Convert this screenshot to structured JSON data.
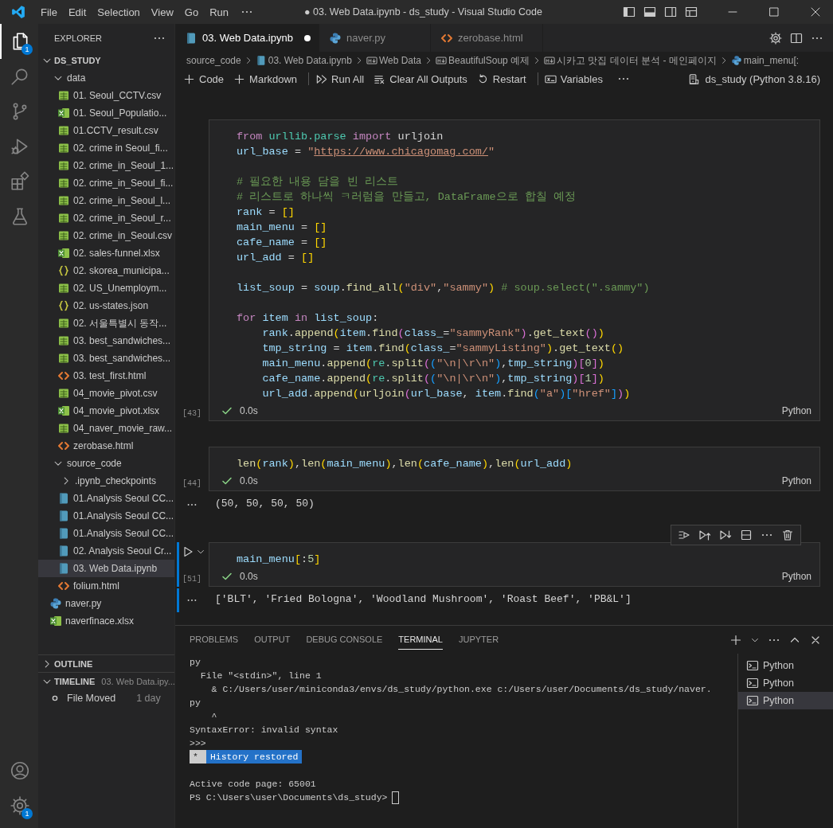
{
  "window": {
    "title": "● 03. Web Data.ipynb - ds_study - Visual Studio Code",
    "menu": [
      "File",
      "Edit",
      "Selection",
      "View",
      "Go",
      "Run"
    ]
  },
  "activity_bar": {
    "top": [
      {
        "kind": "explorer",
        "selected": true,
        "badge": "1"
      },
      {
        "kind": "search",
        "selected": false
      },
      {
        "kind": "source-control",
        "selected": false
      },
      {
        "kind": "run-debug",
        "selected": false
      },
      {
        "kind": "extensions",
        "selected": false
      },
      {
        "kind": "testing",
        "selected": false
      }
    ],
    "bottom": [
      {
        "kind": "account"
      },
      {
        "kind": "settings",
        "badge": "1"
      }
    ]
  },
  "sidebar": {
    "title": "EXPLORER",
    "root": {
      "label": "DS_STUDY",
      "expanded": true
    },
    "tree": [
      {
        "label": "data",
        "kind": "folder",
        "expanded": true,
        "selected": false,
        "children": [
          {
            "label": "01. Seoul_CCTV.csv",
            "kind": "csv",
            "selected": false
          },
          {
            "label": "01. Seoul_Populatio...",
            "kind": "xlsx",
            "selected": false
          },
          {
            "label": "01.CCTV_result.csv",
            "kind": "csv",
            "selected": false
          },
          {
            "label": "02. crime in Seoul_fi...",
            "kind": "csv",
            "selected": false
          },
          {
            "label": "02. crime_in_Seoul_1...",
            "kind": "csv",
            "selected": false
          },
          {
            "label": "02. crime_in_Seoul_fi...",
            "kind": "csv",
            "selected": false
          },
          {
            "label": "02. crime_in_Seoul_l...",
            "kind": "csv",
            "selected": false
          },
          {
            "label": "02. crime_in_Seoul_r...",
            "kind": "csv",
            "selected": false
          },
          {
            "label": "02. crime_in_Seoul.csv",
            "kind": "csv",
            "selected": false
          },
          {
            "label": "02. sales-funnel.xlsx",
            "kind": "xlsx",
            "selected": false
          },
          {
            "label": "02. skorea_municipa...",
            "kind": "json",
            "selected": false
          },
          {
            "label": "02. US_Unemploym...",
            "kind": "csv",
            "selected": false
          },
          {
            "label": "02. us-states.json",
            "kind": "json",
            "selected": false
          },
          {
            "label": "02. 서울특별시 동작...",
            "kind": "csv",
            "selected": false
          },
          {
            "label": "03. best_sandwiches...",
            "kind": "csv",
            "selected": false
          },
          {
            "label": "03. best_sandwiches...",
            "kind": "csv",
            "selected": false
          },
          {
            "label": "03. test_first.html",
            "kind": "html",
            "selected": false
          },
          {
            "label": "04_movie_pivot.csv",
            "kind": "csv",
            "selected": false
          },
          {
            "label": "04_movie_pivot.xlsx",
            "kind": "xlsx",
            "selected": false
          },
          {
            "label": "04_naver_movie_raw...",
            "kind": "csv",
            "selected": false
          },
          {
            "label": "zerobase.html",
            "kind": "html",
            "selected": false
          }
        ]
      },
      {
        "label": "source_code",
        "kind": "folder",
        "expanded": true,
        "selected": false,
        "children": [
          {
            "label": ".ipynb_checkpoints",
            "kind": "folder",
            "expanded": false,
            "selected": false
          },
          {
            "label": "01.Analysis Seoul CC...",
            "kind": "ipynb",
            "selected": false
          },
          {
            "label": "01.Analysis Seoul CC...",
            "kind": "ipynb",
            "selected": false
          },
          {
            "label": "01.Analysis Seoul CC...",
            "kind": "ipynb",
            "selected": false
          },
          {
            "label": "02. Analysis Seoul Cr...",
            "kind": "ipynb",
            "selected": false
          },
          {
            "label": "03. Web Data.ipynb",
            "kind": "ipynb",
            "selected": true
          },
          {
            "label": "folium.html",
            "kind": "html",
            "selected": false
          }
        ]
      },
      {
        "label": "naver.py",
        "kind": "py",
        "selected": false
      },
      {
        "label": "naverfinace.xlsx",
        "kind": "xlsx",
        "selected": false
      }
    ],
    "outline": {
      "label": "OUTLINE",
      "expanded": false
    },
    "timeline": {
      "label": "TIMELINE",
      "expanded": true,
      "file": "03. Web Data.ipy...",
      "items": [
        {
          "label": "File Moved",
          "time": "1 day"
        }
      ]
    }
  },
  "tabs": [
    {
      "label": "03. Web Data.ipynb",
      "kind": "ipynb",
      "selected": true,
      "modified": true
    },
    {
      "label": "naver.py",
      "kind": "py",
      "selected": false,
      "modified": false
    },
    {
      "label": "zerobase.html",
      "kind": "html",
      "selected": false,
      "modified": false
    }
  ],
  "breadcrumbs": [
    {
      "label": "source_code",
      "kind": "folder"
    },
    {
      "label": "03. Web Data.ipynb",
      "kind": "ipynb"
    },
    {
      "label": "Web Data",
      "kind": "markdown"
    },
    {
      "label": "BeautifulSoup 예제",
      "kind": "markdown"
    },
    {
      "label": "시카고 맛집 데이터 분석 - 메인페이지",
      "kind": "markdown"
    },
    {
      "label": "main_menu[:",
      "kind": "py"
    }
  ],
  "toolbar": {
    "groups": [
      [
        {
          "label": "Code",
          "kind": "plus"
        },
        {
          "label": "Markdown",
          "kind": "plus"
        }
      ],
      [
        {
          "label": "Run All",
          "kind": "run-all"
        },
        {
          "label": "Clear All Outputs",
          "kind": "clear"
        },
        {
          "label": "Restart",
          "kind": "restart"
        }
      ],
      [
        {
          "label": "Variables",
          "kind": "variables"
        }
      ]
    ],
    "kernel": "ds_study (Python 3.8.16)"
  },
  "cells": [
    {
      "execution_count": "[43]",
      "time": "0.0s",
      "language": "Python",
      "focused": false,
      "blocks": [
        [
          [
            {
              "kind": "kw",
              "text": "from"
            },
            {
              "kind": "mod",
              "text": " urllib.parse"
            },
            {
              "kind": "kw",
              "text": " import"
            },
            {
              "kind": "plain",
              "text": " urljoin"
            }
          ],
          [
            {
              "kind": "var",
              "text": "url_base"
            },
            {
              "kind": "plain",
              "text": " = "
            },
            {
              "kind": "str",
              "text": "\""
            },
            {
              "kind": "link",
              "text": "https://www.chicagomag.com/"
            },
            {
              "kind": "str",
              "text": "\""
            }
          ]
        ],
        [
          [
            {
              "kind": "cmt",
              "text": "# 필요한 내용 담을 빈 리스트"
            }
          ],
          [
            {
              "kind": "cmt",
              "text": "# 리스트로 하나씩 ㅋ러럼을 만들고, DataFrame으로 합칠 예정"
            }
          ],
          [
            {
              "kind": "var",
              "text": "rank"
            },
            {
              "kind": "plain",
              "text": " = "
            },
            {
              "kind": "b1",
              "text": "[]"
            }
          ],
          [
            {
              "kind": "var",
              "text": "main_menu"
            },
            {
              "kind": "plain",
              "text": " = "
            },
            {
              "kind": "b1",
              "text": "[]"
            }
          ],
          [
            {
              "kind": "var",
              "text": "cafe_name"
            },
            {
              "kind": "plain",
              "text": " = "
            },
            {
              "kind": "b1",
              "text": "[]"
            }
          ],
          [
            {
              "kind": "var",
              "text": "url_add"
            },
            {
              "kind": "plain",
              "text": " = "
            },
            {
              "kind": "b1",
              "text": "[]"
            }
          ]
        ],
        [
          [
            {
              "kind": "var",
              "text": "list_soup"
            },
            {
              "kind": "plain",
              "text": " = "
            },
            {
              "kind": "var",
              "text": "soup"
            },
            {
              "kind": "plain",
              "text": "."
            },
            {
              "kind": "fn",
              "text": "find_all"
            },
            {
              "kind": "b1",
              "text": "("
            },
            {
              "kind": "str",
              "text": "\"div\""
            },
            {
              "kind": "plain",
              "text": ","
            },
            {
              "kind": "str",
              "text": "\"sammy\""
            },
            {
              "kind": "b1",
              "text": ")"
            },
            {
              "kind": "cmt",
              "text": " # soup.select(\".sammy\")"
            }
          ]
        ],
        [
          [
            {
              "kind": "kw",
              "text": "for"
            },
            {
              "kind": "var",
              "text": " item"
            },
            {
              "kind": "kw",
              "text": " in"
            },
            {
              "kind": "var",
              "text": " list_soup"
            },
            {
              "kind": "plain",
              "text": ":"
            }
          ],
          [
            {
              "kind": "var",
              "text": "    rank"
            },
            {
              "kind": "plain",
              "text": "."
            },
            {
              "kind": "fn",
              "text": "append"
            },
            {
              "kind": "b1",
              "text": "("
            },
            {
              "kind": "var",
              "text": "item"
            },
            {
              "kind": "plain",
              "text": "."
            },
            {
              "kind": "fn",
              "text": "find"
            },
            {
              "kind": "b2",
              "text": "("
            },
            {
              "kind": "var",
              "text": "class_"
            },
            {
              "kind": "plain",
              "text": "="
            },
            {
              "kind": "str",
              "text": "\"sammyRank\""
            },
            {
              "kind": "b2",
              "text": ")"
            },
            {
              "kind": "plain",
              "text": "."
            },
            {
              "kind": "fn",
              "text": "get_text"
            },
            {
              "kind": "b2",
              "text": "()"
            },
            {
              "kind": "b1",
              "text": ")"
            }
          ],
          [
            {
              "kind": "var",
              "text": "    tmp_string"
            },
            {
              "kind": "plain",
              "text": " = "
            },
            {
              "kind": "var",
              "text": "item"
            },
            {
              "kind": "plain",
              "text": "."
            },
            {
              "kind": "fn",
              "text": "find"
            },
            {
              "kind": "b1",
              "text": "("
            },
            {
              "kind": "var",
              "text": "class_"
            },
            {
              "kind": "plain",
              "text": "="
            },
            {
              "kind": "str",
              "text": "\"sammyListing\""
            },
            {
              "kind": "b1",
              "text": ")"
            },
            {
              "kind": "plain",
              "text": "."
            },
            {
              "kind": "fn",
              "text": "get_text"
            },
            {
              "kind": "b1",
              "text": "()"
            }
          ],
          [
            {
              "kind": "var",
              "text": "    main_menu"
            },
            {
              "kind": "plain",
              "text": "."
            },
            {
              "kind": "fn",
              "text": "append"
            },
            {
              "kind": "b1",
              "text": "("
            },
            {
              "kind": "mod",
              "text": "re"
            },
            {
              "kind": "plain",
              "text": "."
            },
            {
              "kind": "fn",
              "text": "split"
            },
            {
              "kind": "b2",
              "text": "("
            },
            {
              "kind": "b3",
              "text": "("
            },
            {
              "kind": "str",
              "text": "\"\\n|\\r\\n\""
            },
            {
              "kind": "b3",
              "text": ")"
            },
            {
              "kind": "plain",
              "text": ","
            },
            {
              "kind": "var",
              "text": "tmp_string"
            },
            {
              "kind": "b2",
              "text": ")["
            },
            {
              "kind": "num",
              "text": "0"
            },
            {
              "kind": "b2",
              "text": "]"
            },
            {
              "kind": "b1",
              "text": ")"
            }
          ],
          [
            {
              "kind": "var",
              "text": "    cafe_name"
            },
            {
              "kind": "plain",
              "text": "."
            },
            {
              "kind": "fn",
              "text": "append"
            },
            {
              "kind": "b1",
              "text": "("
            },
            {
              "kind": "mod",
              "text": "re"
            },
            {
              "kind": "plain",
              "text": "."
            },
            {
              "kind": "fn",
              "text": "split"
            },
            {
              "kind": "b2",
              "text": "("
            },
            {
              "kind": "b3",
              "text": "("
            },
            {
              "kind": "str",
              "text": "\"\\n|\\r\\n\""
            },
            {
              "kind": "b3",
              "text": ")"
            },
            {
              "kind": "plain",
              "text": ","
            },
            {
              "kind": "var",
              "text": "tmp_string"
            },
            {
              "kind": "b2",
              "text": ")["
            },
            {
              "kind": "num",
              "text": "1"
            },
            {
              "kind": "b2",
              "text": "]"
            },
            {
              "kind": "b1",
              "text": ")"
            }
          ],
          [
            {
              "kind": "var",
              "text": "    url_add"
            },
            {
              "kind": "plain",
              "text": "."
            },
            {
              "kind": "fn",
              "text": "append"
            },
            {
              "kind": "b1",
              "text": "("
            },
            {
              "kind": "fn",
              "text": "urljoin"
            },
            {
              "kind": "b2",
              "text": "("
            },
            {
              "kind": "var",
              "text": "url_base"
            },
            {
              "kind": "plain",
              "text": ", "
            },
            {
              "kind": "var",
              "text": "item"
            },
            {
              "kind": "plain",
              "text": "."
            },
            {
              "kind": "fn",
              "text": "find"
            },
            {
              "kind": "b3",
              "text": "("
            },
            {
              "kind": "str",
              "text": "\"a\""
            },
            {
              "kind": "b3",
              "text": ")["
            },
            {
              "kind": "str",
              "text": "\"href\""
            },
            {
              "kind": "b3",
              "text": "]"
            },
            {
              "kind": "b2",
              "text": ")"
            },
            {
              "kind": "b1",
              "text": ")"
            }
          ]
        ]
      ]
    },
    {
      "execution_count": "[44]",
      "time": "0.0s",
      "language": "Python",
      "focused": false,
      "output": "(50, 50, 50, 50)",
      "blocks": [
        [
          [
            {
              "kind": "fn",
              "text": "len"
            },
            {
              "kind": "b1",
              "text": "("
            },
            {
              "kind": "var",
              "text": "rank"
            },
            {
              "kind": "b1",
              "text": ")"
            },
            {
              "kind": "plain",
              "text": ","
            },
            {
              "kind": "fn",
              "text": "len"
            },
            {
              "kind": "b1",
              "text": "("
            },
            {
              "kind": "var",
              "text": "main_menu"
            },
            {
              "kind": "b1",
              "text": ")"
            },
            {
              "kind": "plain",
              "text": ","
            },
            {
              "kind": "fn",
              "text": "len"
            },
            {
              "kind": "b1",
              "text": "("
            },
            {
              "kind": "var",
              "text": "cafe_name"
            },
            {
              "kind": "b1",
              "text": ")"
            },
            {
              "kind": "plain",
              "text": ","
            },
            {
              "kind": "fn",
              "text": "len"
            },
            {
              "kind": "b1",
              "text": "("
            },
            {
              "kind": "var",
              "text": "url_add"
            },
            {
              "kind": "b1",
              "text": ")"
            }
          ]
        ]
      ]
    },
    {
      "execution_count": "[51]",
      "time": "0.0s",
      "language": "Python",
      "focused": true,
      "output": "['BLT', 'Fried Bologna', 'Woodland Mushroom', 'Roast Beef', 'PB&L']",
      "blocks": [
        [
          [
            {
              "kind": "var",
              "text": "main_menu"
            },
            {
              "kind": "b1",
              "text": "["
            },
            {
              "kind": "plain",
              "text": ":"
            },
            {
              "kind": "num",
              "text": "5"
            },
            {
              "kind": "b1",
              "text": "]"
            }
          ]
        ]
      ]
    }
  ],
  "panel": {
    "tabs": [
      {
        "label": "PROBLEMS",
        "selected": false
      },
      {
        "label": "OUTPUT",
        "selected": false
      },
      {
        "label": "DEBUG CONSOLE",
        "selected": false
      },
      {
        "label": "TERMINAL",
        "selected": true
      },
      {
        "label": "JUPYTER",
        "selected": false
      }
    ],
    "terminal": {
      "blocks": [
        [
          {
            "kind": "text",
            "text": "py"
          },
          {
            "kind": "text",
            "text": "  File \"<stdin>\", line 1"
          },
          {
            "kind": "text",
            "text": "    & C:/Users/user/miniconda3/envs/ds_study/python.exe c:/Users/user/Documents/ds_study/naver."
          },
          {
            "kind": "text",
            "text": "py"
          },
          {
            "kind": "text",
            "text": "    ^"
          },
          {
            "kind": "text",
            "text": "SyntaxError: invalid syntax"
          },
          {
            "kind": "text",
            "text": ">>>"
          },
          {
            "kind": "badge",
            "mark": "*",
            "text": "History restored"
          }
        ],
        [
          {
            "kind": "text",
            "text": "Active code page: 65001"
          },
          {
            "kind": "prompt",
            "text": "PS C:\\Users\\user\\Documents\\ds_study>"
          }
        ]
      ]
    },
    "terminals": [
      {
        "label": "Python",
        "selected": false
      },
      {
        "label": "Python",
        "selected": false
      },
      {
        "label": "Python",
        "selected": true
      }
    ]
  }
}
